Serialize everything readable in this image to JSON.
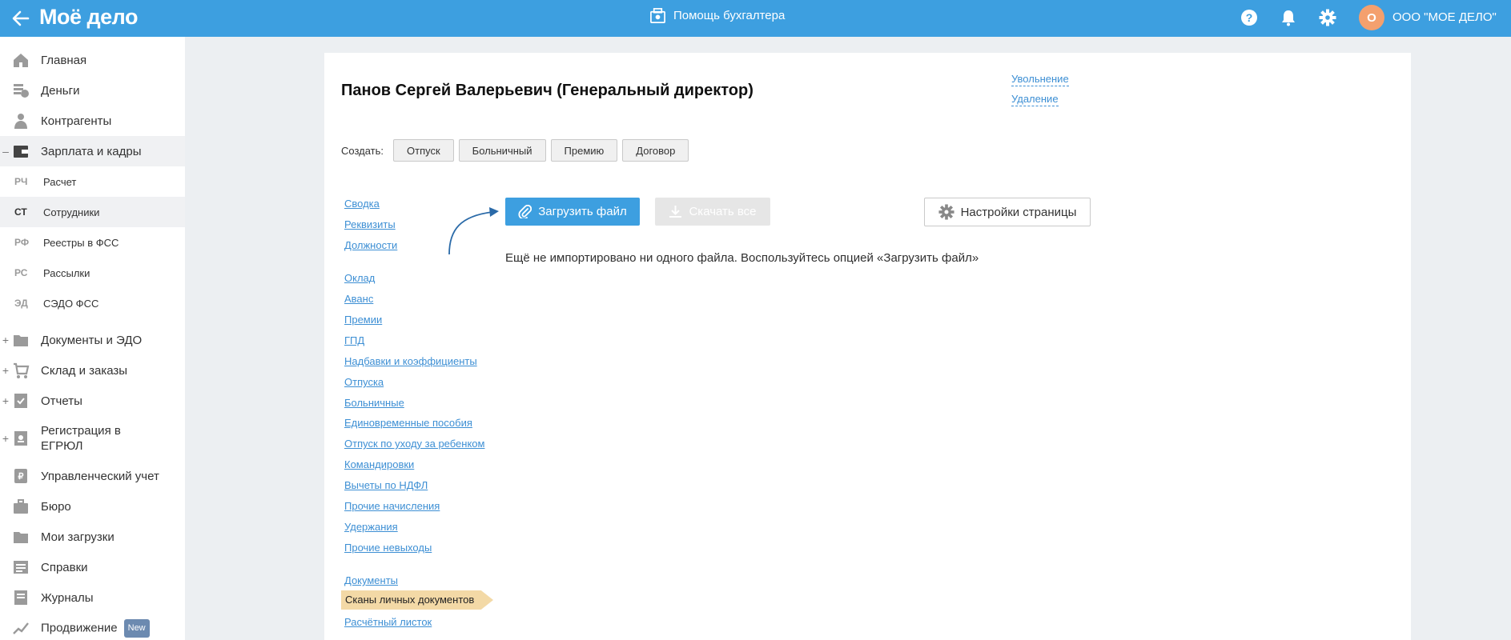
{
  "header": {
    "logo": "Моё дело",
    "help_center": "Помощь бухгалтера",
    "org_initial": "О",
    "org_name": "ООО \"МОЕ ДЕЛО\"",
    "accent_color": "#3d9fe0"
  },
  "sidebar": {
    "items": [
      {
        "label": "Главная",
        "icon": "home-icon"
      },
      {
        "label": "Деньги",
        "icon": "money-icon"
      },
      {
        "label": "Контрагенты",
        "icon": "contractors-icon"
      },
      {
        "label": "Зарплата и кадры",
        "icon": "wallet-icon",
        "toggle": "–"
      },
      {
        "label": "Документы и ЭДО",
        "icon": "folder-icon",
        "toggle": "+"
      },
      {
        "label": "Склад и заказы",
        "icon": "cart-icon",
        "toggle": "+"
      },
      {
        "label": "Отчеты",
        "icon": "report-icon",
        "toggle": "+"
      },
      {
        "label": "Регистрация в ЕГРЮЛ",
        "icon": "registration-icon",
        "toggle": "+"
      },
      {
        "label": "Управленческий учет",
        "icon": "management-icon"
      },
      {
        "label": "Бюро",
        "icon": "briefcase-icon"
      },
      {
        "label": "Мои загрузки",
        "icon": "downloads-icon"
      },
      {
        "label": "Справки",
        "icon": "references-icon"
      },
      {
        "label": "Журналы",
        "icon": "journals-icon"
      },
      {
        "label": "Продвижение",
        "icon": "promotion-icon",
        "badge": "New"
      }
    ],
    "subitems": [
      {
        "abbr": "РЧ",
        "label": "Расчет"
      },
      {
        "abbr": "СТ",
        "label": "Сотрудники"
      },
      {
        "abbr": "РФ",
        "label": "Реестры в ФСС"
      },
      {
        "abbr": "РС",
        "label": "Рассылки"
      },
      {
        "abbr": "ЭД",
        "label": "СЭДО ФСС"
      }
    ]
  },
  "employee": {
    "title": "Панов Сергей Валерьевич (Генеральный директор)",
    "dismiss_link": "Увольнение",
    "delete_link": "Удаление"
  },
  "create": {
    "label": "Создать:",
    "buttons": [
      "Отпуск",
      "Больничный",
      "Премию",
      "Договор"
    ]
  },
  "side_links": [
    "Сводка",
    "Реквизиты",
    "Должности",
    "Оклад",
    "Аванс",
    "Премии",
    "ГПД",
    "Надбавки и коэффициенты",
    "Отпуска",
    "Больничные",
    "Единовременные пособия",
    "Отпуск по уходу за ребенком",
    "Командировки",
    "Вычеты по НДФЛ",
    "Прочие начисления",
    "Удержания",
    "Прочие невыходы",
    "Документы",
    "Сканы личных документов",
    "Расчётный листок"
  ],
  "active_side_link": "Сканы личных документов",
  "actions": {
    "upload": "Загрузить файл",
    "download_all": "Скачать все",
    "page_settings": "Настройки страницы"
  },
  "empty_message": "Ещё не импортировано ни одного файла. Воспользуйтесь опцией «Загрузить файл»"
}
